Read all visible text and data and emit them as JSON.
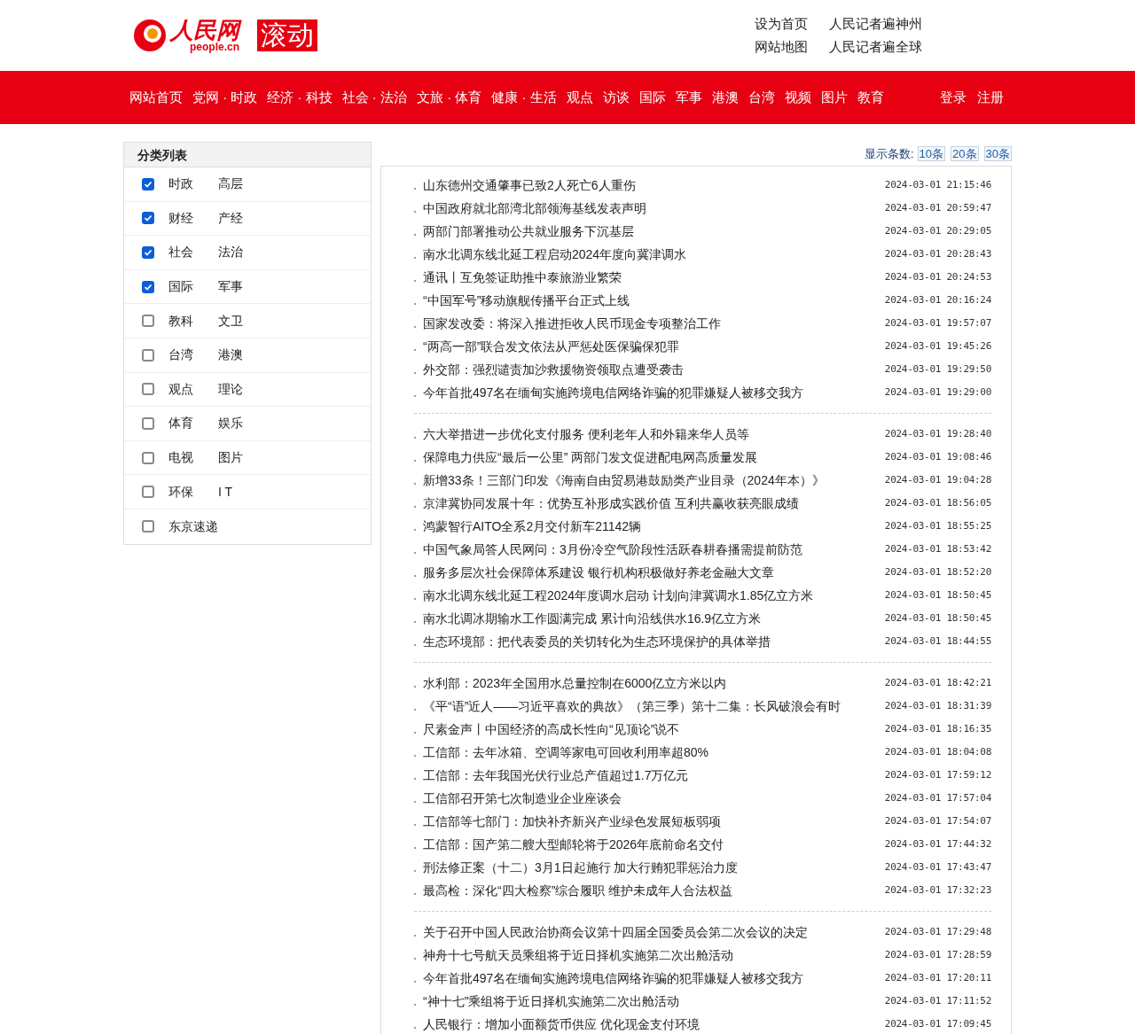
{
  "header": {
    "logo_text": "人民网",
    "logo_sub": "people.cn",
    "section_badge": "滚动",
    "top_links": [
      [
        "设为首页",
        "人民记者遍神州"
      ],
      [
        "网站地图",
        "人民记者遍全球"
      ]
    ]
  },
  "nav": {
    "items": [
      "网站首页",
      "党网 · 时政",
      "经济 · 科技",
      "社会 · 法治",
      "文旅 · 体育",
      "健康 · 生活",
      "观点",
      "访谈",
      "国际",
      "军事",
      "港澳",
      "台湾",
      "视频",
      "图片",
      "教育"
    ],
    "right_links": [
      "登录",
      "注册"
    ]
  },
  "sidebar": {
    "title": "分类列表",
    "categories": [
      {
        "labels": [
          "时政",
          "高层"
        ],
        "checked": true
      },
      {
        "labels": [
          "财经",
          "产经"
        ],
        "checked": true
      },
      {
        "labels": [
          "社会",
          "法治"
        ],
        "checked": true
      },
      {
        "labels": [
          "国际",
          "军事"
        ],
        "checked": true
      },
      {
        "labels": [
          "教科",
          "文卫"
        ],
        "checked": false
      },
      {
        "labels": [
          "台湾",
          "港澳"
        ],
        "checked": false
      },
      {
        "labels": [
          "观点",
          "理论"
        ],
        "checked": false
      },
      {
        "labels": [
          "体育",
          "娱乐"
        ],
        "checked": false
      },
      {
        "labels": [
          "电视",
          "图片"
        ],
        "checked": false
      },
      {
        "labels": [
          "环保",
          "I T"
        ],
        "checked": false
      },
      {
        "labels": [
          "东京速递"
        ],
        "checked": false
      }
    ]
  },
  "page_size": {
    "label": "显示条数:",
    "options": [
      "10条",
      "20条",
      "30条"
    ]
  },
  "news_groups": [
    [
      {
        "title": "山东德州交通肇事已致2人死亡6人重伤",
        "time": "2024-03-01 21:15:46"
      },
      {
        "title": "中国政府就北部湾北部领海基线发表声明",
        "time": "2024-03-01 20:59:47"
      },
      {
        "title": "两部门部署推动公共就业服务下沉基层",
        "time": "2024-03-01 20:29:05"
      },
      {
        "title": "南水北调东线北延工程启动2024年度向冀津调水",
        "time": "2024-03-01 20:28:43"
      },
      {
        "title": "通讯丨互免签证助推中泰旅游业繁荣",
        "time": "2024-03-01 20:24:53"
      },
      {
        "title": "“中国军号”移动旗舰传播平台正式上线",
        "time": "2024-03-01 20:16:24"
      },
      {
        "title": "国家发改委：将深入推进拒收人民币现金专项整治工作",
        "time": "2024-03-01 19:57:07"
      },
      {
        "title": "“两高一部”联合发文依法从严惩处医保骗保犯罪",
        "time": "2024-03-01 19:45:26"
      },
      {
        "title": "外交部：强烈谴责加沙救援物资领取点遭受袭击",
        "time": "2024-03-01 19:29:50"
      },
      {
        "title": "今年首批497名在缅甸实施跨境电信网络诈骗的犯罪嫌疑人被移交我方",
        "time": "2024-03-01 19:29:00"
      }
    ],
    [
      {
        "title": "六大举措进一步优化支付服务 便利老年人和外籍来华人员等",
        "time": "2024-03-01 19:28:40"
      },
      {
        "title": "保障电力供应“最后一公里” 两部门发文促进配电网高质量发展",
        "time": "2024-03-01 19:08:46"
      },
      {
        "title": "新增33条！三部门印发《海南自由贸易港鼓励类产业目录（2024年本）》",
        "time": "2024-03-01 19:04:28"
      },
      {
        "title": "京津冀协同发展十年：优势互补形成实践价值 互利共赢收获亮眼成绩",
        "time": "2024-03-01 18:56:05"
      },
      {
        "title": "鸿蒙智行AITO全系2月交付新车21142辆",
        "time": "2024-03-01 18:55:25"
      },
      {
        "title": "中国气象局答人民网问：3月份冷空气阶段性活跃春耕春播需提前防范",
        "time": "2024-03-01 18:53:42"
      },
      {
        "title": "服务多层次社会保障体系建设 银行机构积极做好养老金融大文章",
        "time": "2024-03-01 18:52:20"
      },
      {
        "title": "南水北调东线北延工程2024年度调水启动 计划向津冀调水1.85亿立方米",
        "time": "2024-03-01 18:50:45"
      },
      {
        "title": "南水北调冰期输水工作圆满完成 累计向沿线供水16.9亿立方米",
        "time": "2024-03-01 18:50:45"
      },
      {
        "title": "生态环境部：把代表委员的关切转化为生态环境保护的具体举措",
        "time": "2024-03-01 18:44:55"
      }
    ],
    [
      {
        "title": "水利部：2023年全国用水总量控制在6000亿立方米以内",
        "time": "2024-03-01 18:42:21"
      },
      {
        "title": "《平“语”近人——习近平喜欢的典故》（第三季）第十二集：长风破浪会有时",
        "time": "2024-03-01 18:31:39"
      },
      {
        "title": "尺素金声丨中国经济的高成长性向“见顶论”说不",
        "time": "2024-03-01 18:16:35"
      },
      {
        "title": "工信部：去年冰箱、空调等家电可回收利用率超80%",
        "time": "2024-03-01 18:04:08"
      },
      {
        "title": "工信部：去年我国光伏行业总产值超过1.7万亿元",
        "time": "2024-03-01 17:59:12"
      },
      {
        "title": "工信部召开第七次制造业企业座谈会",
        "time": "2024-03-01 17:57:04"
      },
      {
        "title": "工信部等七部门：加快补齐新兴产业绿色发展短板弱项",
        "time": "2024-03-01 17:54:07"
      },
      {
        "title": "工信部：国产第二艘大型邮轮将于2026年底前命名交付",
        "time": "2024-03-01 17:44:32"
      },
      {
        "title": "刑法修正案（十二）3月1日起施行 加大行贿犯罪惩治力度",
        "time": "2024-03-01 17:43:47"
      },
      {
        "title": "最高检：深化“四大检察”综合履职 维护未成年人合法权益",
        "time": "2024-03-01 17:32:23"
      }
    ],
    [
      {
        "title": "关于召开中国人民政治协商会议第十四届全国委员会第二次会议的决定",
        "time": "2024-03-01 17:29:48"
      },
      {
        "title": "神舟十七号航天员乘组将于近日择机实施第二次出舱活动",
        "time": "2024-03-01 17:28:59"
      },
      {
        "title": "今年首批497名在缅甸实施跨境电信网络诈骗的犯罪嫌疑人被移交我方",
        "time": "2024-03-01 17:20:11"
      },
      {
        "title": "“神十七”乘组将于近日择机实施第二次出舱活动",
        "time": "2024-03-01 17:11:52"
      },
      {
        "title": "人民银行：增加小面额货币供应 优化现金支付环境",
        "time": "2024-03-01 17:09:45"
      }
    ]
  ]
}
